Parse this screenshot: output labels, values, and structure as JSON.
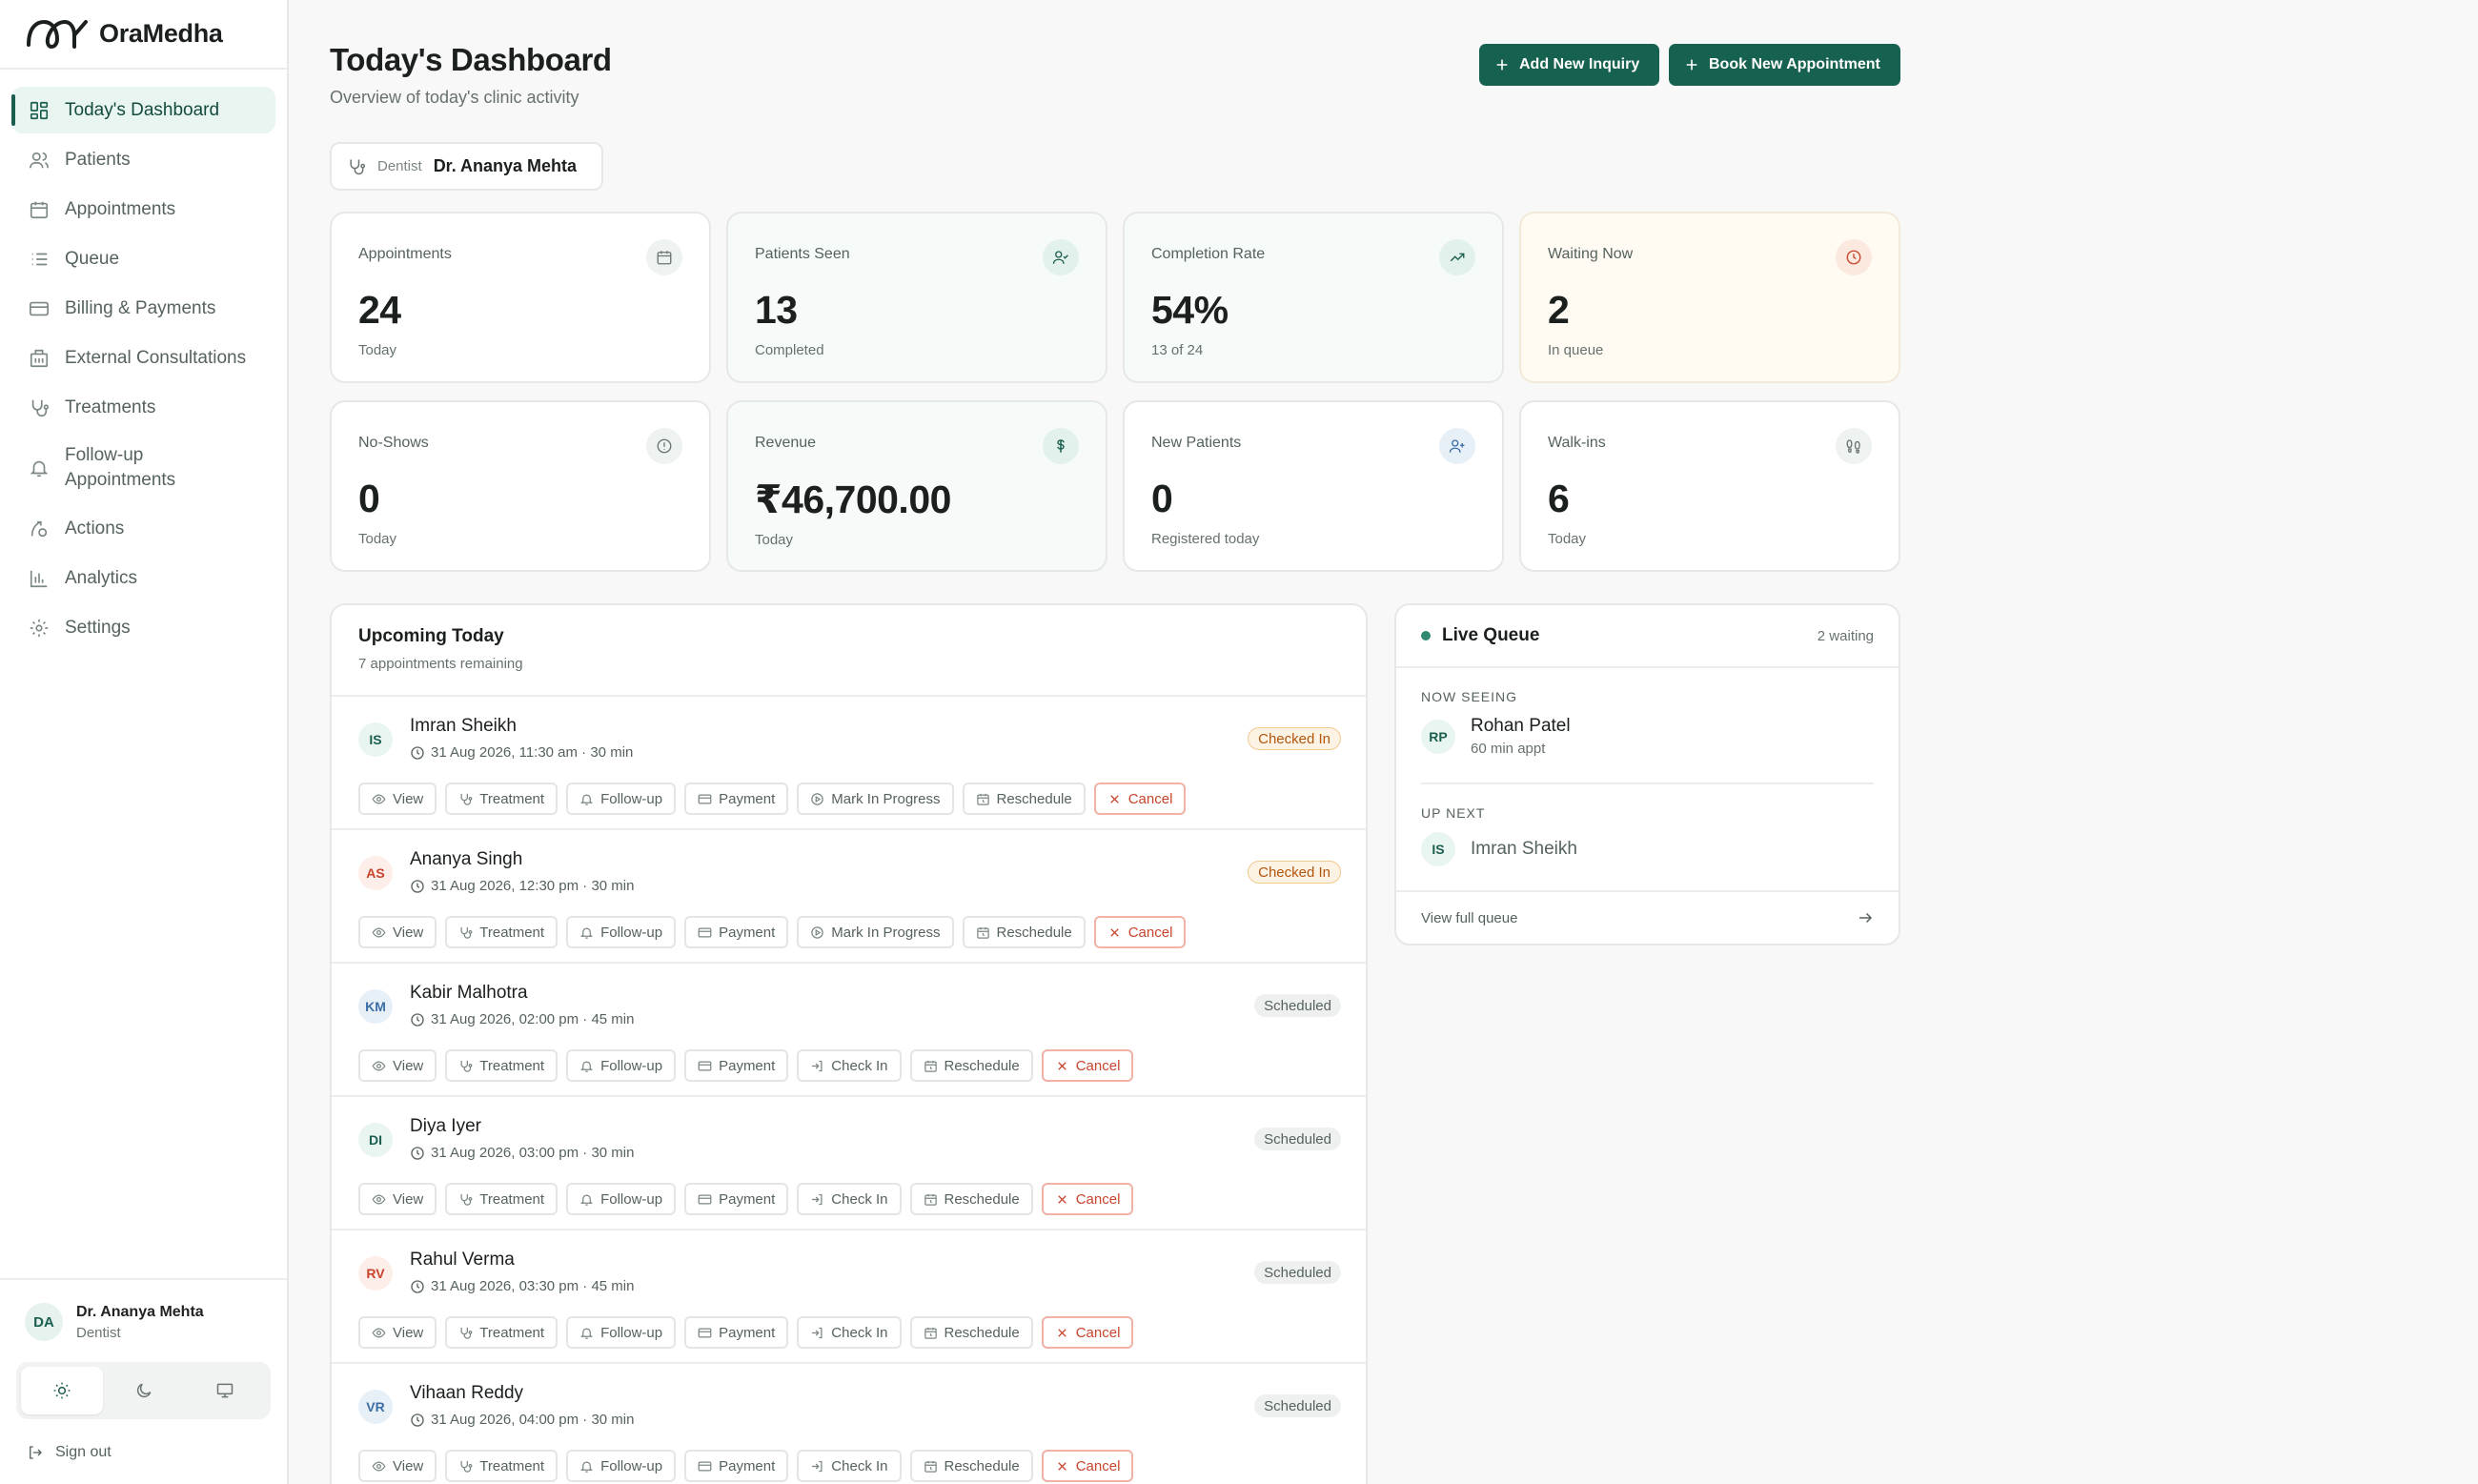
{
  "brand": {
    "name": "OraMedha"
  },
  "sidebar": {
    "items": [
      {
        "label": "Today's Dashboard",
        "icon": "dashboard-icon"
      },
      {
        "label": "Patients",
        "icon": "users-icon"
      },
      {
        "label": "Appointments",
        "icon": "calendar-icon"
      },
      {
        "label": "Queue",
        "icon": "list-icon"
      },
      {
        "label": "Billing & Payments",
        "icon": "card-icon"
      },
      {
        "label": "External Consultations",
        "icon": "building-icon"
      },
      {
        "label": "Treatments",
        "icon": "stethoscope-icon"
      },
      {
        "label": "Follow-up Appointments",
        "icon": "bell-icon"
      },
      {
        "label": "Actions",
        "icon": "actions-icon"
      },
      {
        "label": "Analytics",
        "icon": "chart-icon"
      },
      {
        "label": "Settings",
        "icon": "gear-icon"
      }
    ],
    "user": {
      "initials": "DA",
      "name": "Dr. Ananya Mehta",
      "role": "Dentist"
    },
    "signout": "Sign out"
  },
  "header": {
    "title": "Today's Dashboard",
    "subtitle": "Overview of today's clinic activity",
    "add_inquiry": "Add New Inquiry",
    "book_appointment": "Book New Appointment"
  },
  "dentist": {
    "label": "Dentist",
    "value": "Dr. Ananya Mehta"
  },
  "stats": [
    {
      "title": "Appointments",
      "value": "24",
      "sub": "Today"
    },
    {
      "title": "Patients Seen",
      "value": "13",
      "sub": "Completed"
    },
    {
      "title": "Completion Rate",
      "value": "54%",
      "sub": "13 of 24"
    },
    {
      "title": "Waiting Now",
      "value": "2",
      "sub": "In queue"
    },
    {
      "title": "No-Shows",
      "value": "0",
      "sub": "Today"
    },
    {
      "title": "Revenue",
      "value": "₹46,700.00",
      "sub": "Today"
    },
    {
      "title": "New Patients",
      "value": "0",
      "sub": "Registered today"
    },
    {
      "title": "Walk-ins",
      "value": "6",
      "sub": "Today"
    }
  ],
  "upcoming": {
    "title": "Upcoming Today",
    "subtitle": "7 appointments remaining",
    "rows": [
      {
        "initials": "IS",
        "name": "Imran Sheikh",
        "time": "31 Aug 2026, 11:30 am · 30 min",
        "status": "Checked In",
        "actions": [
          "View",
          "Treatment",
          "Follow-up",
          "Payment",
          "Mark In Progress",
          "Reschedule",
          "Cancel"
        ]
      },
      {
        "initials": "AS",
        "name": "Ananya Singh",
        "time": "31 Aug 2026, 12:30 pm · 30 min",
        "status": "Checked In",
        "actions": [
          "View",
          "Treatment",
          "Follow-up",
          "Payment",
          "Mark In Progress",
          "Reschedule",
          "Cancel"
        ]
      },
      {
        "initials": "KM",
        "name": "Kabir Malhotra",
        "time": "31 Aug 2026, 02:00 pm · 45 min",
        "status": "Scheduled",
        "actions": [
          "View",
          "Treatment",
          "Follow-up",
          "Payment",
          "Check In",
          "Reschedule",
          "Cancel"
        ]
      },
      {
        "initials": "DI",
        "name": "Diya Iyer",
        "time": "31 Aug 2026, 03:00 pm · 30 min",
        "status": "Scheduled",
        "actions": [
          "View",
          "Treatment",
          "Follow-up",
          "Payment",
          "Check In",
          "Reschedule",
          "Cancel"
        ]
      },
      {
        "initials": "RV",
        "name": "Rahul Verma",
        "time": "31 Aug 2026, 03:30 pm · 45 min",
        "status": "Scheduled",
        "actions": [
          "View",
          "Treatment",
          "Follow-up",
          "Payment",
          "Check In",
          "Reschedule",
          "Cancel"
        ]
      },
      {
        "initials": "VR",
        "name": "Vihaan Reddy",
        "time": "31 Aug 2026, 04:00 pm · 30 min",
        "status": "Scheduled",
        "actions": [
          "View",
          "Treatment",
          "Follow-up",
          "Payment",
          "Check In",
          "Reschedule",
          "Cancel"
        ]
      }
    ]
  },
  "queue": {
    "title": "Live Queue",
    "count": "2 waiting",
    "now_label": "NOW SEEING",
    "now": {
      "initials": "RP",
      "name": "Rohan Patel",
      "meta": "60 min appt"
    },
    "next_label": "UP NEXT",
    "next": {
      "initials": "IS",
      "name": "Imran Sheikh"
    },
    "footer": "View full queue"
  },
  "colors": {
    "accent": "#16614f",
    "checked_in": "#b1560e",
    "cancel": "#c8442c"
  }
}
